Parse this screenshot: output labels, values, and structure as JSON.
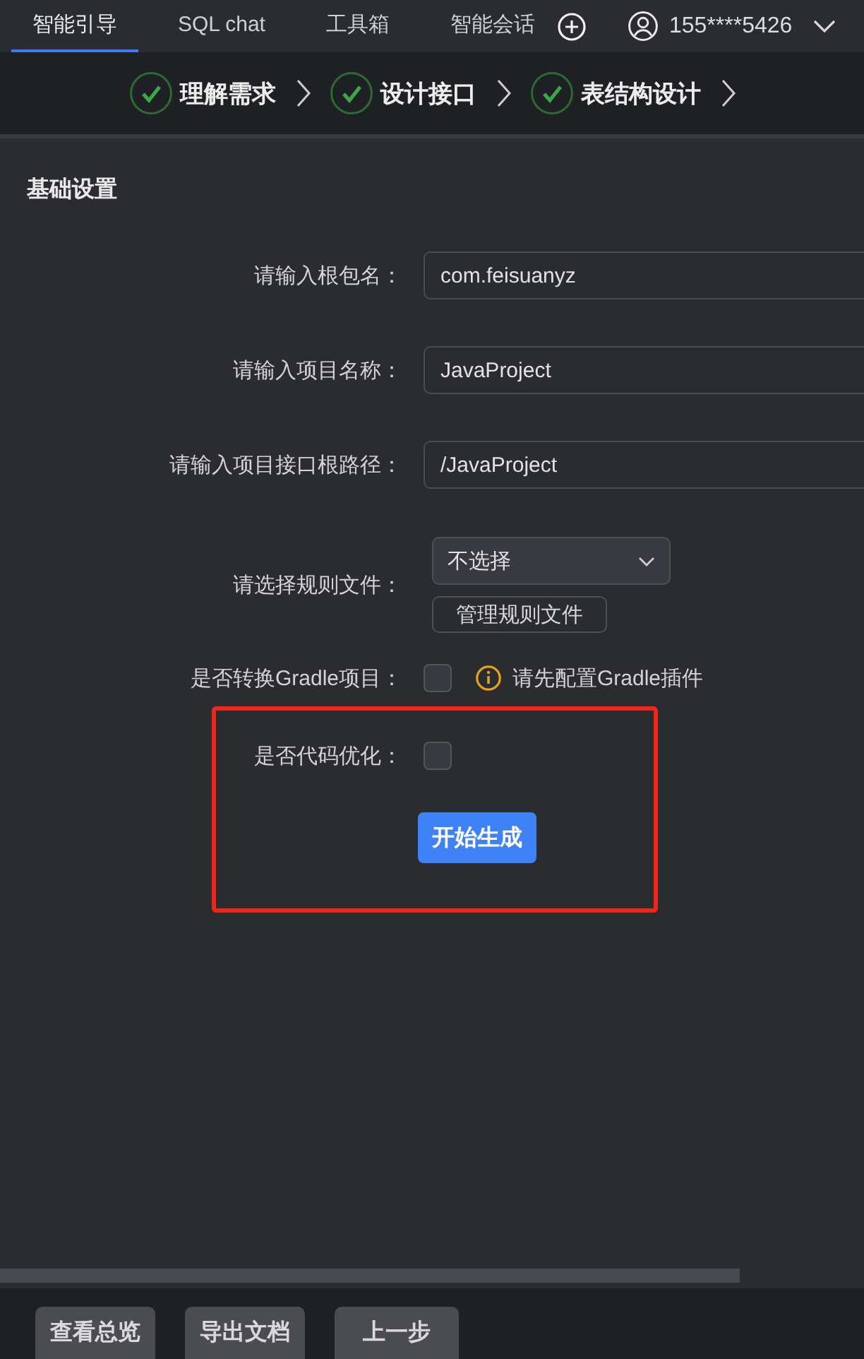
{
  "tabs": [
    {
      "label": "智能引导",
      "selected": true
    },
    {
      "label": "SQL chat",
      "selected": false
    },
    {
      "label": "工具箱",
      "selected": false
    },
    {
      "label": "智能会话",
      "selected": false
    }
  ],
  "account": {
    "phone": "155****5426"
  },
  "steps": [
    {
      "label": "理解需求",
      "done": true
    },
    {
      "label": "设计接口",
      "done": true
    },
    {
      "label": "表结构设计",
      "done": true
    }
  ],
  "section": {
    "title": "基础设置"
  },
  "fields": [
    {
      "kind": "text",
      "label": "请输入根包名：",
      "value": "com.feisuanyz"
    },
    {
      "kind": "text",
      "label": "请输入项目名称：",
      "value": "JavaProject"
    },
    {
      "kind": "text",
      "label": "请输入项目接口根路径：",
      "value": "/JavaProject"
    },
    {
      "kind": "select",
      "label": "请选择规则文件：",
      "value": "不选择",
      "button": "管理规则文件"
    },
    {
      "kind": "checkbox",
      "label": "是否转换Gradle项目：",
      "checked": false,
      "hint": "请先配置Gradle插件"
    }
  ],
  "generate_panel": {
    "highlighted": true,
    "option": {
      "label": "是否代码优化：",
      "checked": false
    },
    "button": "开始生成"
  },
  "footer_buttons": [
    "查看总览",
    "导出文档",
    "上一步"
  ]
}
